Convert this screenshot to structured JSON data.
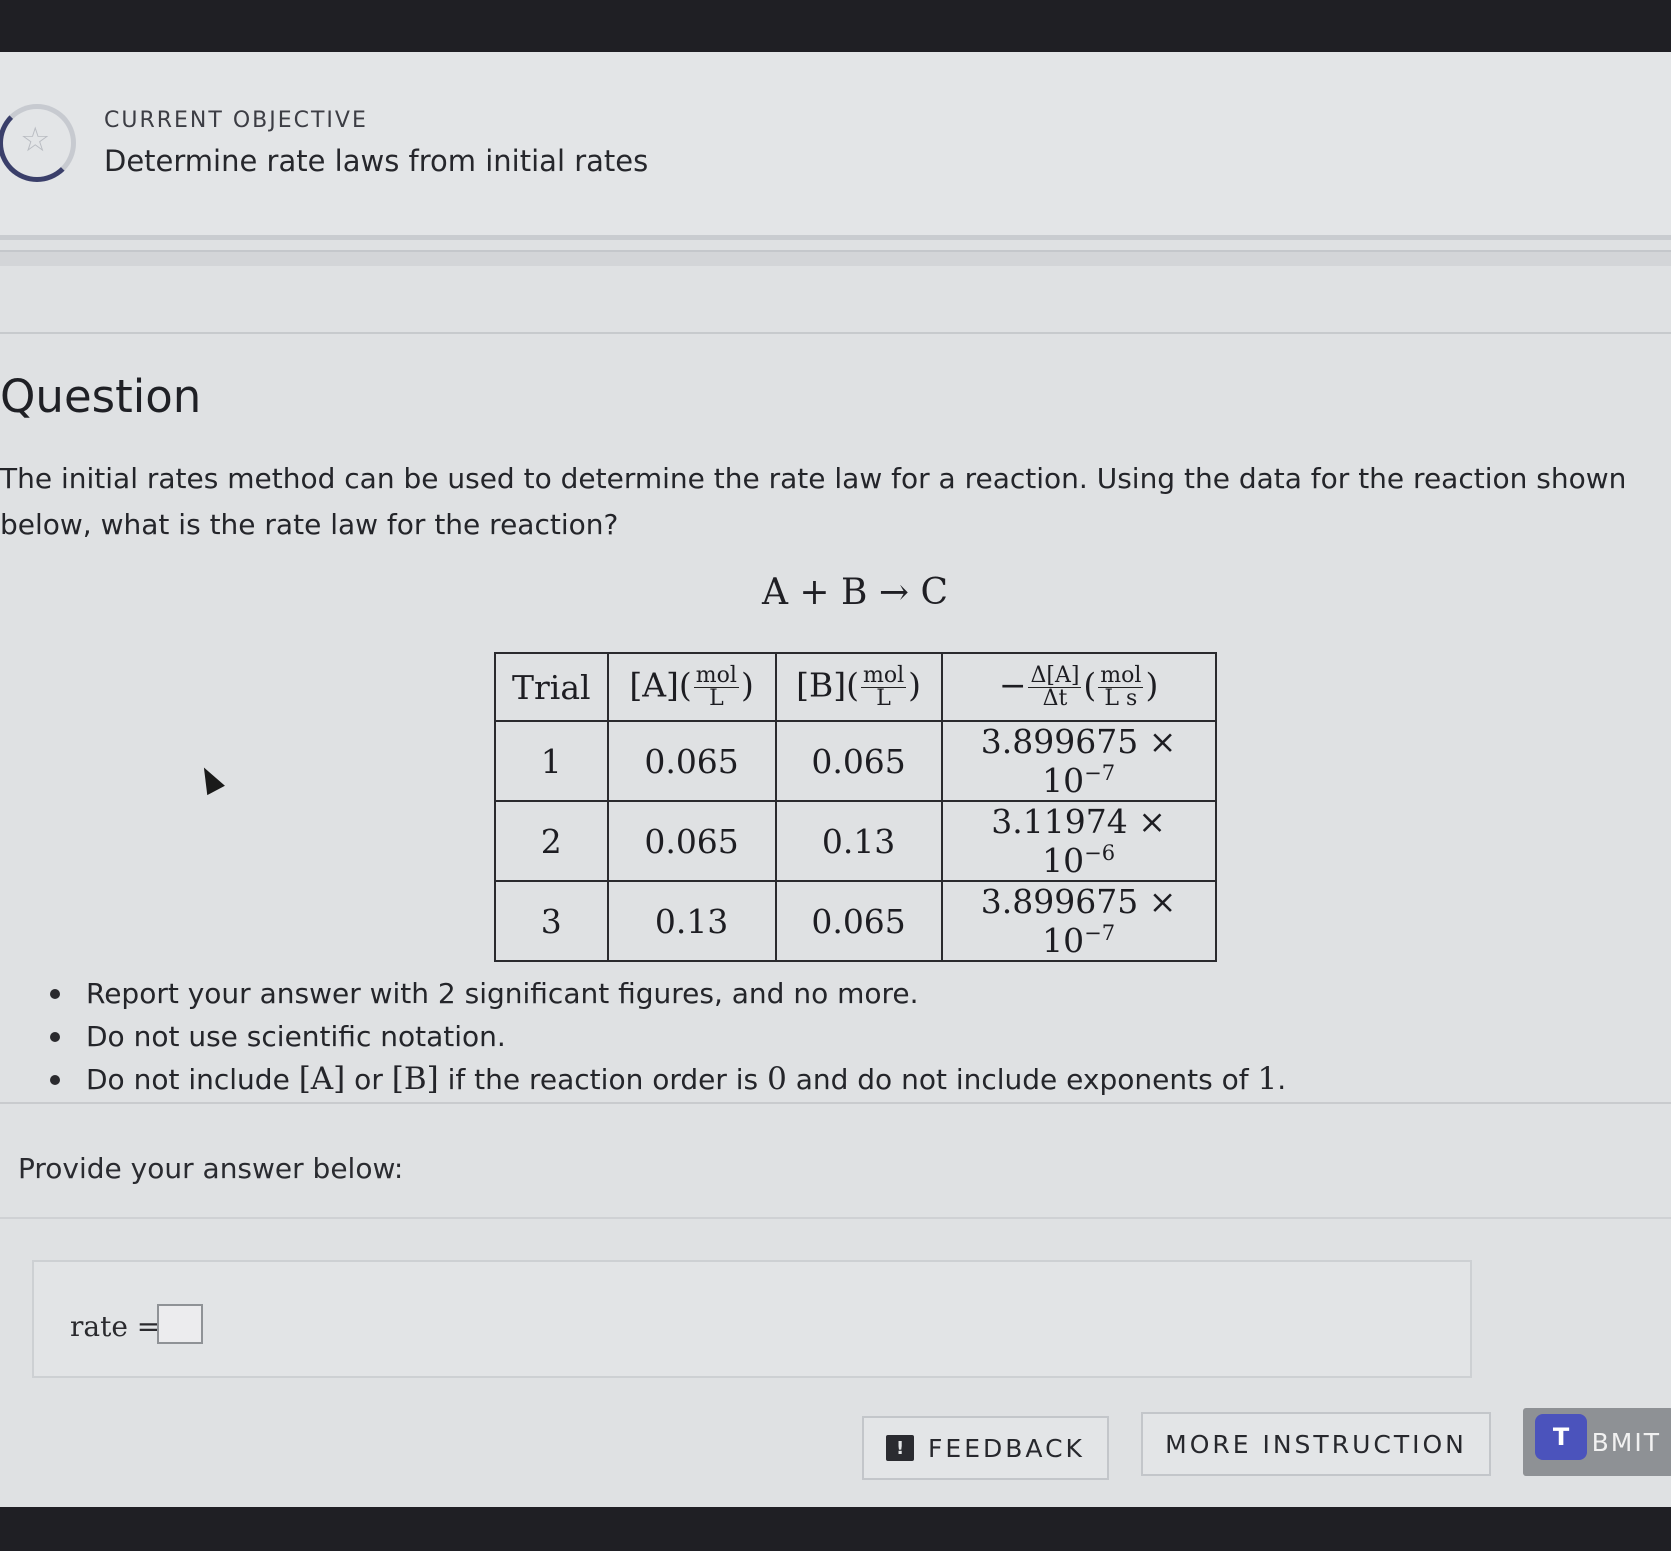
{
  "objective": {
    "label": "CURRENT OBJECTIVE",
    "title": "Determine rate laws from initial rates"
  },
  "question": {
    "heading": "Question",
    "text": "The initial rates method can be used to determine the rate law for a reaction. Using the data for the reaction shown below, what is the rate law for the reaction?",
    "reaction": "A + B → C"
  },
  "table": {
    "headers": {
      "trial": "Trial",
      "a_prefix": "[A](",
      "b_prefix": "[B](",
      "unit_num": "mol",
      "unit_den": "L",
      "rate_neg": "−",
      "rate_num": "Δ[A]",
      "rate_den": "Δt",
      "rate_unit_num": "mol",
      "rate_unit_den": "L s",
      "close": ")"
    },
    "rows": [
      {
        "trial": "1",
        "a": "0.065",
        "b": "0.065",
        "rate_base": "3.899675 × 10",
        "rate_exp": "−7"
      },
      {
        "trial": "2",
        "a": "0.065",
        "b": "0.13",
        "rate_base": "3.11974 × 10",
        "rate_exp": "−6"
      },
      {
        "trial": "3",
        "a": "0.13",
        "b": "0.065",
        "rate_base": "3.899675 × 10",
        "rate_exp": "−7"
      }
    ]
  },
  "rules": {
    "r1": "Report your answer with 2 significant figures, and no more.",
    "r2": "Do not use scientific notation.",
    "r3_a": "Do not include ",
    "r3_A": "[A]",
    "r3_or": " or ",
    "r3_B": "[B]",
    "r3_b": " if the reaction order is ",
    "r3_zero": "0",
    "r3_c": " and do not include exponents of ",
    "r3_one": "1",
    "r3_end": "."
  },
  "answer": {
    "prompt": "Provide your answer below:",
    "rate_label": "rate =",
    "rate_value": ""
  },
  "buttons": {
    "feedback": "FEEDBACK",
    "more_instruction": "MORE INSTRUCTION",
    "submit": "BMIT"
  },
  "icons": {
    "objective": "star-icon",
    "feedback": "feedback-icon",
    "teams": "teams-icon"
  }
}
